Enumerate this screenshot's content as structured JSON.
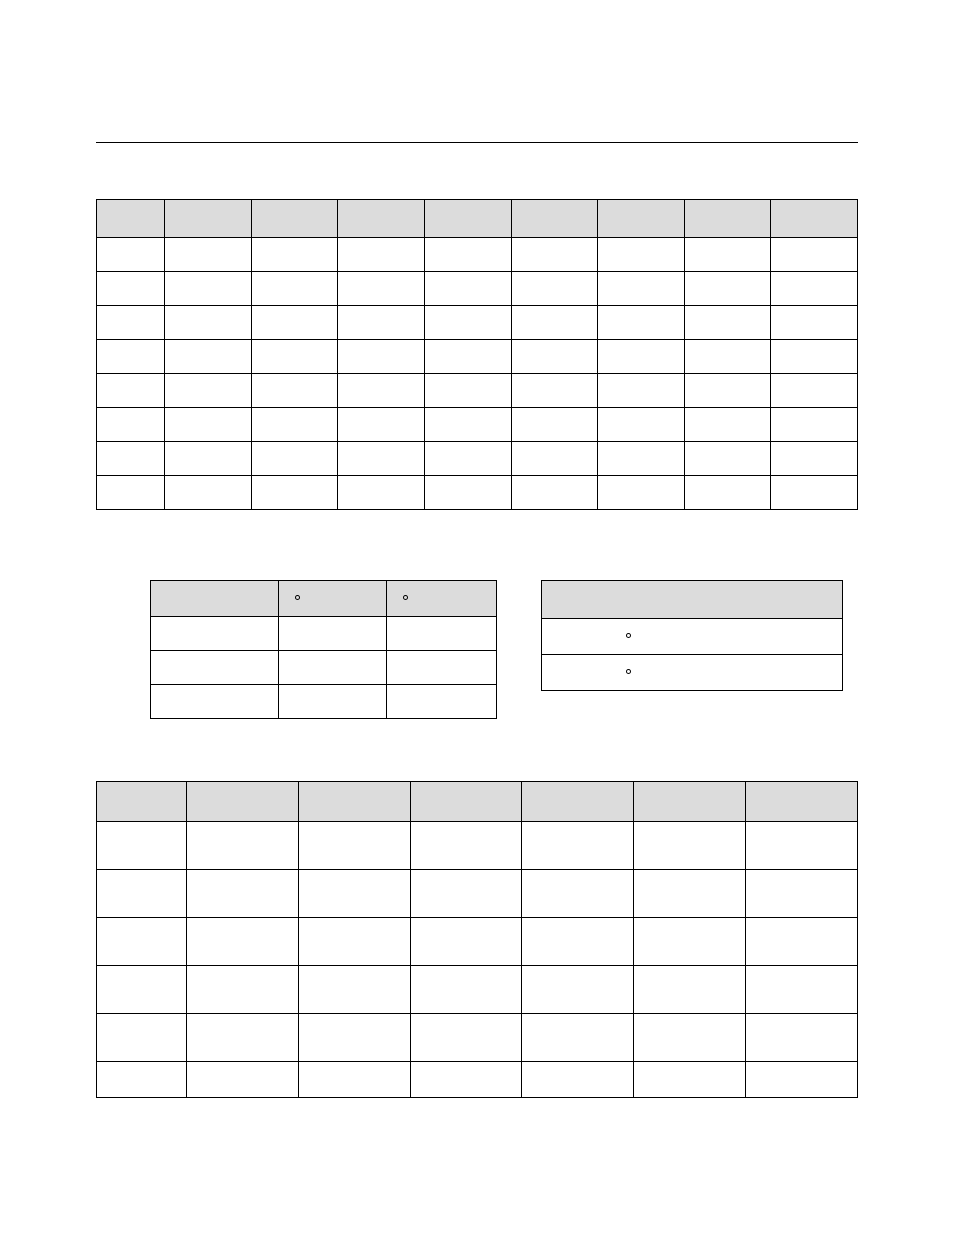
{
  "page": {
    "hairline": true
  },
  "table1": {
    "columns": [
      "",
      "",
      "",
      "",
      "",
      "",
      "",
      "",
      ""
    ],
    "rows": [
      [
        "",
        "",
        "",
        "",
        "",
        "",
        "",
        "",
        ""
      ],
      [
        "",
        "",
        "",
        "",
        "",
        "",
        "",
        "",
        ""
      ],
      [
        "",
        "",
        "",
        "",
        "",
        "",
        "",
        "",
        ""
      ],
      [
        "",
        "",
        "",
        "",
        "",
        "",
        "",
        "",
        ""
      ],
      [
        "",
        "",
        "",
        "",
        "",
        "",
        "",
        "",
        ""
      ],
      [
        "",
        "",
        "",
        "",
        "",
        "",
        "",
        "",
        ""
      ],
      [
        "",
        "",
        "",
        "",
        "",
        "",
        "",
        "",
        ""
      ],
      [
        "",
        "",
        "",
        "",
        "",
        "",
        "",
        "",
        ""
      ]
    ]
  },
  "table2": {
    "header_dots": [
      false,
      true,
      true
    ],
    "rows": [
      [
        "",
        "",
        ""
      ],
      [
        "",
        "",
        ""
      ],
      [
        "",
        "",
        ""
      ]
    ]
  },
  "table3": {
    "header": "",
    "row_dots": [
      true,
      true
    ]
  },
  "table4": {
    "columns": [
      "",
      "",
      "",
      "",
      "",
      "",
      ""
    ],
    "rows": [
      [
        "",
        "",
        "",
        "",
        "",
        "",
        ""
      ],
      [
        "",
        "",
        "",
        "",
        "",
        "",
        ""
      ],
      [
        "",
        "",
        "",
        "",
        "",
        "",
        ""
      ],
      [
        "",
        "",
        "",
        "",
        "",
        "",
        ""
      ],
      [
        "",
        "",
        "",
        "",
        "",
        "",
        ""
      ],
      [
        "",
        "",
        "",
        "",
        "",
        "",
        ""
      ]
    ]
  }
}
